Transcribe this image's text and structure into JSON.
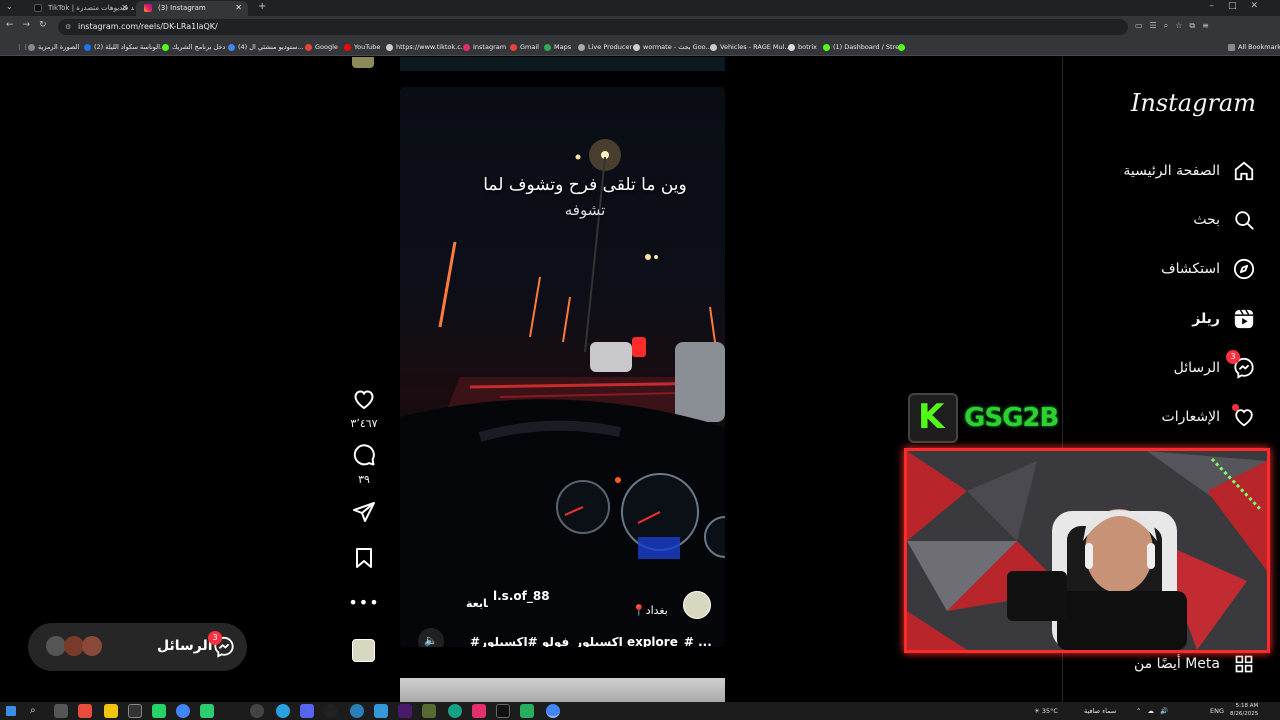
{
  "browser": {
    "tabs": [
      {
        "title": "TikTok | شاهد فيديوهات متصدرة",
        "active": false
      },
      {
        "title": "(3) Instagram",
        "active": true
      }
    ],
    "url": "instagram.com/reels/DK-LRa1IaQK/",
    "bookmarks": [
      "الصورة الرمزية",
      "(2) الوناسة سكواد الليلة...",
      "دخل برنامج الشريك",
      "(4) ستوديو منشئي ال...",
      "Google",
      "YouTube",
      "https://www.tiktok.c...",
      "Instagram",
      "Gmail",
      "Maps",
      "Live Producer",
      "wormate - بحث Goo...",
      "Vehicles - RAGE Mul...",
      "botrix",
      "(1) Dashboard / Stre...",
      "All Bookmarks"
    ]
  },
  "instagram": {
    "logo": "Instagram",
    "nav": [
      {
        "label": "الصفحة الرئيسية",
        "icon": "home-icon"
      },
      {
        "label": "بحث",
        "icon": "search-icon"
      },
      {
        "label": "استكشاف",
        "icon": "explore-icon"
      },
      {
        "label": "ريلز",
        "icon": "reels-icon"
      },
      {
        "label": "الرسائل",
        "icon": "messenger-icon",
        "badge": "3"
      },
      {
        "label": "الإشعارات",
        "icon": "heart-icon"
      }
    ],
    "also_from_meta": "أيضًا من Meta"
  },
  "reel": {
    "overlay_text_line1": "وين ما تلقى فرح وتشوف لما",
    "overlay_text_line2": "تشوفه",
    "username": "l.s.of_88",
    "follow": "متابعة",
    "location": "بغداد",
    "caption": "#اكسبلور_فولو #اكسبلور explore_# ... المزيد",
    "likes": "٣٬٤٦٧",
    "comments": "٣٩"
  },
  "messages_pill": {
    "label": "الرسائل",
    "badge": "3"
  },
  "stream_overlay": {
    "brand_text": "GSG2B",
    "logo_letter": "K"
  },
  "taskbar": {
    "weather": "35°C",
    "weather_label": "سماء صافية",
    "lang": "ENG",
    "time": "5:18 AM",
    "date": "8/26/2025"
  },
  "colors": {
    "accent_red": "#ff3040",
    "stream_border": "#ff2a2a",
    "brand_green": "#2fd12f"
  }
}
